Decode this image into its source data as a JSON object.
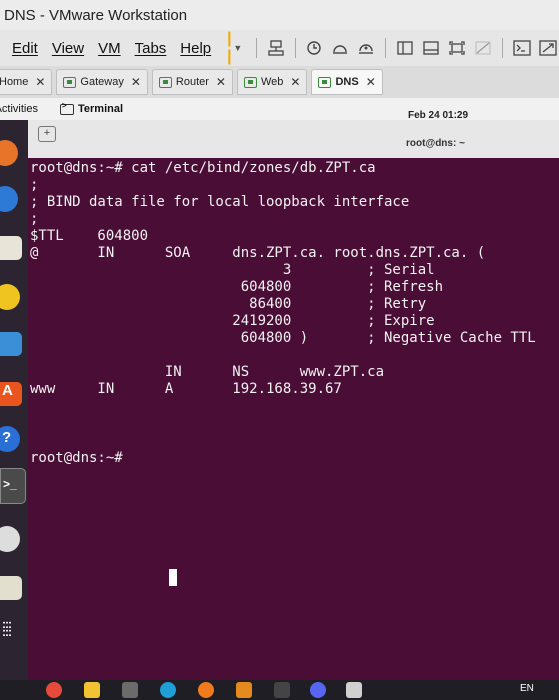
{
  "window": {
    "title": "DNS - VMware Workstation"
  },
  "menu": [
    "Edit",
    "View",
    "VM",
    "Tabs",
    "Help"
  ],
  "toolbar_icons": [
    "pause-icon",
    "send-keys-icon",
    "snapshot-icon",
    "revert-snapshot-icon",
    "manage-snapshots-icon",
    "sidebar-icon",
    "console-view-icon",
    "fullscreen-icon",
    "unity-icon",
    "terminal-view-icon",
    "resize-icon"
  ],
  "tabs": [
    {
      "label": "Home",
      "active": false
    },
    {
      "label": "Gateway",
      "active": false
    },
    {
      "label": "Router",
      "active": false
    },
    {
      "label": "Web",
      "active": false
    },
    {
      "label": "DNS",
      "active": true
    }
  ],
  "gnome": {
    "activities": "Activities",
    "app_menu": "Terminal",
    "clock": "Feb 24 01:29"
  },
  "terminal": {
    "header_title": "root@dns: ~",
    "lines": [
      "root@dns:~# cat /etc/bind/zones/db.ZPT.ca",
      ";",
      "; BIND data file for local loopback interface",
      ";",
      "$TTL    604800",
      "@       IN      SOA     dns.ZPT.ca. root.dns.ZPT.ca. (",
      "                              3         ; Serial",
      "                         604800         ; Refresh",
      "                          86400         ; Retry",
      "                        2419200         ; Expire",
      "                         604800 )       ; Negative Cache TTL",
      "",
      "                IN      NS      www.ZPT.ca",
      "www     IN      A       192.168.39.67",
      "",
      "",
      "root@dns:~# "
    ]
  },
  "taskbar": {
    "tray_text": "EN"
  },
  "colors": {
    "terminal_bg": "#4a0d36",
    "dock_bg": "#2c2430",
    "pause_accent": "#f2a900"
  }
}
